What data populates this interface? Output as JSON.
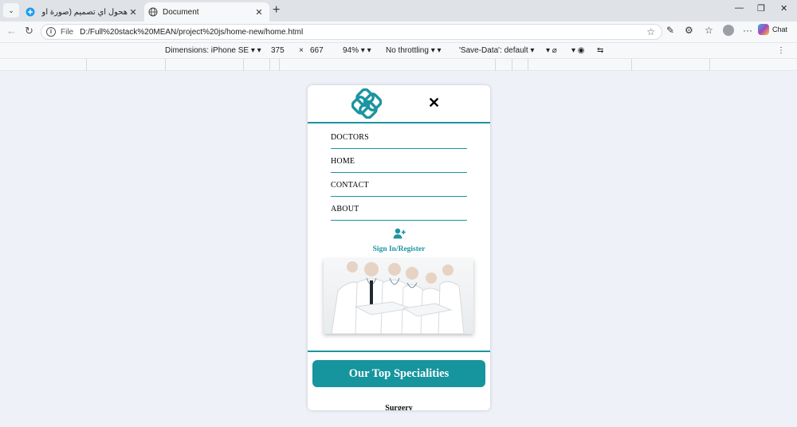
{
  "browser": {
    "tabs": [
      {
        "title": "هحول أي تصميم (صورة أو Figma) إ...",
        "active": false
      },
      {
        "title": "Document",
        "active": true
      }
    ],
    "address": {
      "scheme_label": "File",
      "url": "D:/Full%20stack%20MEAN/project%20js/home-new/home.html"
    },
    "chat_label": "Chat"
  },
  "devtools": {
    "dimensions_label": "Dimensions: iPhone SE",
    "width": "375",
    "times": "×",
    "height": "667",
    "zoom": "94%",
    "throttling": "No throttling",
    "save_data": "'Save-Data': default"
  },
  "site": {
    "nav": [
      "DOCTORS",
      "HOME",
      "CONTACT",
      "ABOUT"
    ],
    "signin_label": "Sign In/Register",
    "specialities_label": "Our Top Specialities",
    "partial_label": "Surgery"
  },
  "colors": {
    "accent": "#1b95a0",
    "button": "#16959e"
  }
}
